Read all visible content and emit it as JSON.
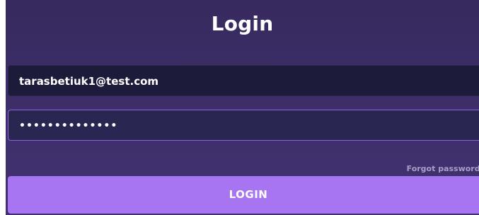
{
  "login": {
    "title": "Login",
    "email_value": "tarasbetiuk1@test.com",
    "password_value": "••••••••••••••",
    "forgot_label": "Forgot password?",
    "login_button_label": "LOGIN"
  },
  "colors": {
    "panel_background": "#3d2e68",
    "email_field_background": "#1d1b3a",
    "password_field_background": "#2a2652",
    "password_field_border": "#8a63e0",
    "login_button": "#a774f2",
    "forgot_text": "#a89ec6"
  }
}
